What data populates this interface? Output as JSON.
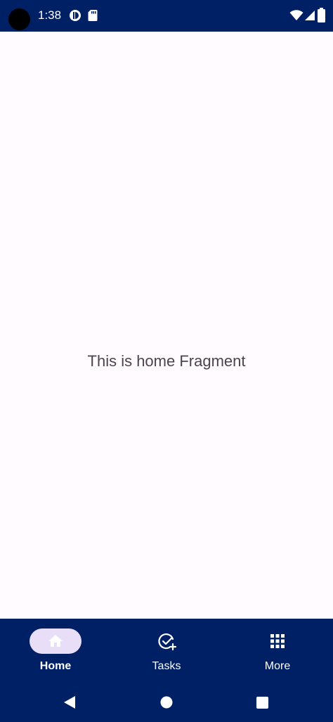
{
  "status_bar": {
    "time": "1:38",
    "icons": [
      "camera-cutout",
      "data-saver-icon",
      "sd-card-icon",
      "wifi-icon",
      "cell-signal-icon",
      "battery-icon"
    ]
  },
  "content": {
    "message": "This is home Fragment"
  },
  "bottom_nav": {
    "items": [
      {
        "label": "Home",
        "icon": "home-icon",
        "active": true
      },
      {
        "label": "Tasks",
        "icon": "task-add-icon",
        "active": false
      },
      {
        "label": "More",
        "icon": "grid-icon",
        "active": false
      }
    ]
  },
  "system_nav": {
    "buttons": [
      "back-icon",
      "home-circle-icon",
      "recents-icon"
    ]
  },
  "colors": {
    "bar_background": "#002066",
    "content_background": "#fffbfe",
    "active_indicator": "#e8def8",
    "text": "#49454f",
    "on_bar": "#ffffff"
  }
}
